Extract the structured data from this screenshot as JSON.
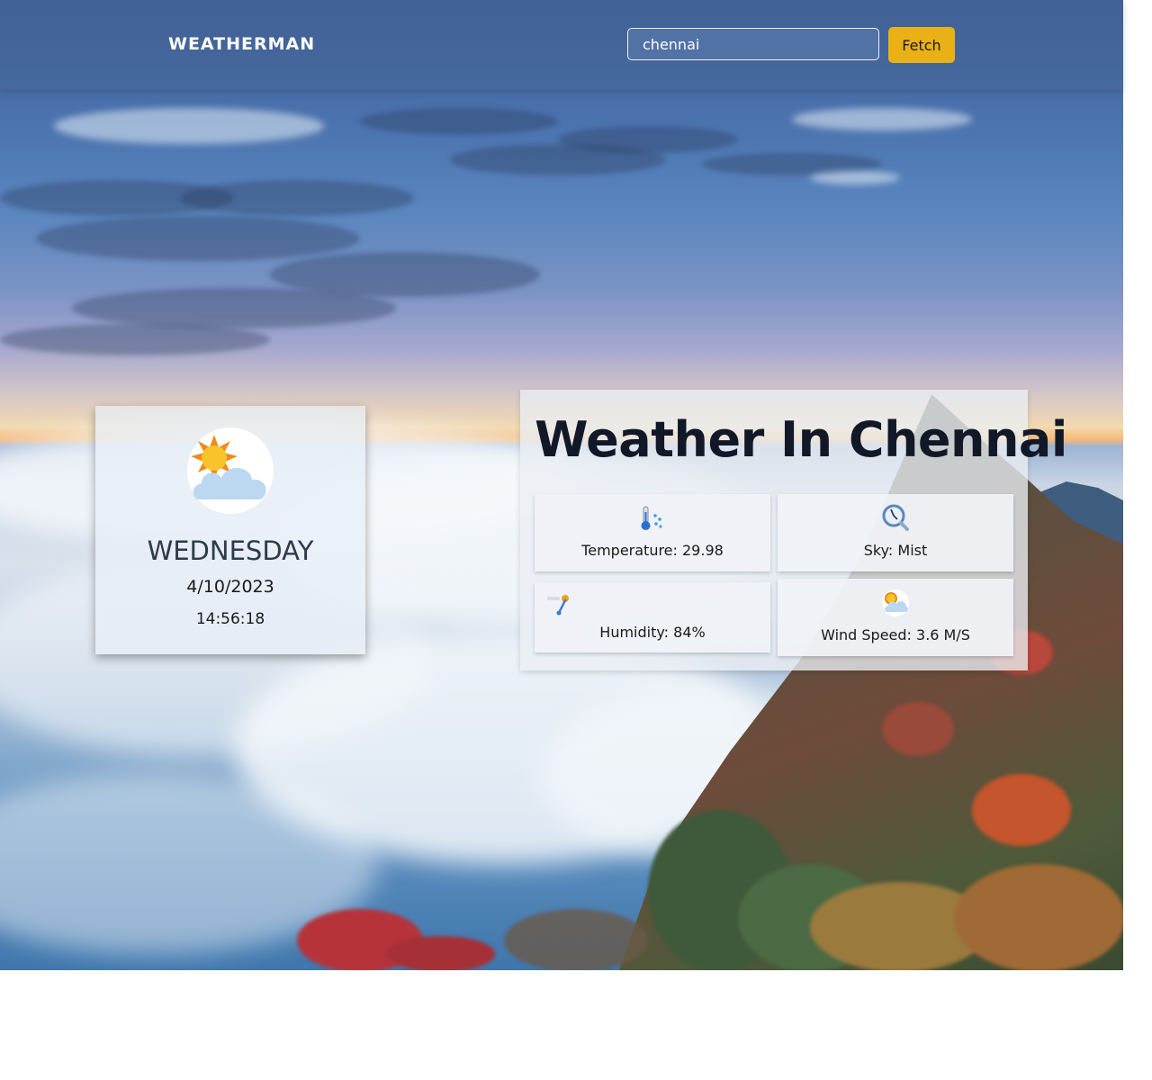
{
  "navbar": {
    "brand": "WEATHERMAN",
    "search": {
      "value": "chennai",
      "placeholder": ""
    },
    "fetch_label": "Fetch"
  },
  "day_card": {
    "icon": "sun-behind-cloud-icon",
    "day": "WEDNESDAY",
    "date": "4/10/2023",
    "time": "14:56:18"
  },
  "panel": {
    "title": "Weather In Chennai",
    "stats": {
      "temperature": {
        "icon": "thermometer-icon",
        "label": "Temperature: 29.98"
      },
      "sky": {
        "icon": "magnifier-icon",
        "label": "Sky: Mist"
      },
      "humidity": {
        "icon": "humidity-icon",
        "label": "Humidity: 84%"
      },
      "wind": {
        "icon": "sun-behind-cloud-icon",
        "label": "Wind Speed: 3.6 M/S"
      }
    }
  },
  "colors": {
    "accent": "#e9b115",
    "title_text": "#111827"
  }
}
